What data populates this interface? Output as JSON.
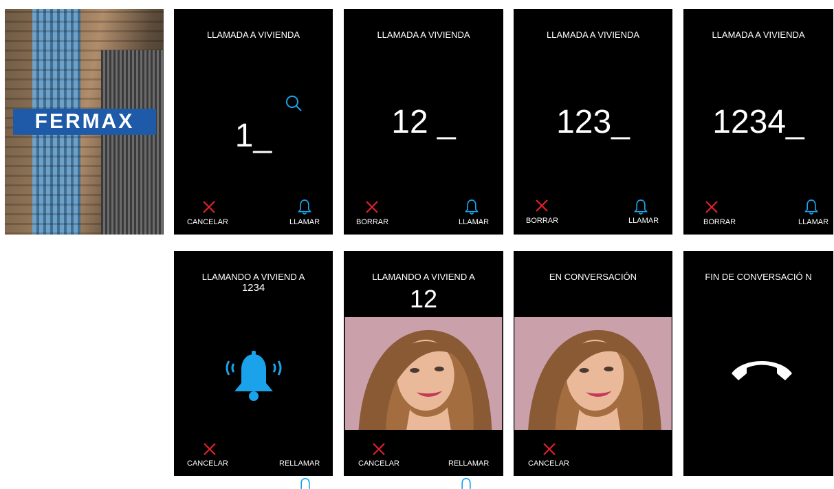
{
  "brand": {
    "logo_text": "FERMAX"
  },
  "colors": {
    "background": "#000000",
    "text": "#ffffff",
    "accent": "#1aa3ea",
    "cancel": "#e0222a"
  },
  "icons": [
    "search-icon",
    "close-icon",
    "bell-icon",
    "bell-ringing-icon",
    "hangup-phone-icon"
  ],
  "screens": [
    {
      "title": "LLAMADA A VIVIENDA",
      "digits": "1_",
      "left_label": "CANCELAR",
      "right_label": "LLAMAR"
    },
    {
      "title": "LLAMADA A VIVIENDA",
      "digits": "12 _",
      "left_label": "BORRAR",
      "right_label": "LLAMAR"
    },
    {
      "title": "LLAMADA A VIVIENDA",
      "digits": "123_",
      "left_label": "BORRAR",
      "right_label": "LLAMAR"
    },
    {
      "title": "LLAMADA A VIVIENDA",
      "digits": "1234_",
      "left_label": "BORRAR",
      "right_label": "LLAMAR"
    },
    {
      "title": "LLAMANDO A VIVIEND A",
      "subtitle": "1234",
      "left_label": "CANCELAR",
      "right_label": "RELLAMAR"
    },
    {
      "title": "LLAMANDO A VIVIEND A",
      "subtitle": "12",
      "left_label": "CANCELAR",
      "right_label": "RELLAMAR"
    },
    {
      "title": "EN CONVERSACIÓN",
      "left_label": "CANCELAR"
    },
    {
      "title": "FIN DE CONVERSACIÓ N"
    }
  ]
}
